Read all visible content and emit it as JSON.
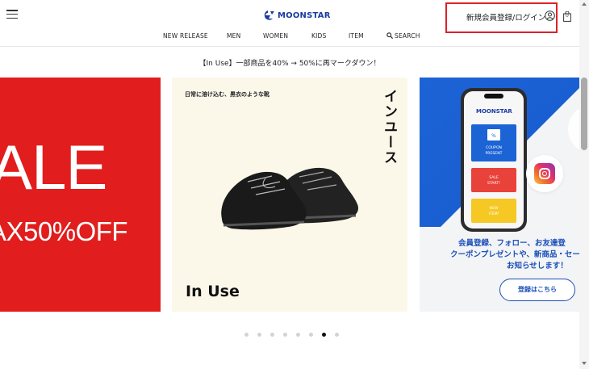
{
  "header": {
    "menu_icon": "hamburger-menu-icon",
    "logo_text": "MOONSTAR",
    "brand_color": "#1b3aa0",
    "account_link": "新規会員登録/ログイン",
    "user_icon": "user-circle-icon",
    "bag_icon": "shopping-bag-icon",
    "bag_count": "0",
    "highlight_color": "#e0202a"
  },
  "nav": {
    "items": [
      {
        "label": "NEW RELEASE"
      },
      {
        "label": "MEN"
      },
      {
        "label": "WOMEN"
      },
      {
        "label": "KIDS"
      },
      {
        "label": "ITEM"
      },
      {
        "label": "SEARCH",
        "icon": "search-icon"
      }
    ]
  },
  "announcement": "【In Use】一部商品を40% → 50%に再マークダウン！",
  "carousel": {
    "slides": [
      {
        "big": "ALE",
        "sub": "AX50%OFF",
        "bg": "#e11d1d"
      },
      {
        "caption": "日常に溶け込む、黒衣のような靴",
        "vertical": "インユース",
        "title": "In Use",
        "bg": "#fbf8ea"
      },
      {
        "phone_brand": "MOONSTAR",
        "cards": [
          "COUPON PRESENT",
          "SALE START!",
          "NEW ITEM!"
        ],
        "lines": [
          "会員登録、フォロー、お友達登",
          "クーポンプレゼントや、新商品・セー",
          "お知らせします！"
        ],
        "button": "登録はこちら",
        "accent": "#1b4fb8"
      }
    ],
    "dots_total": 8,
    "active_dot": 7
  }
}
